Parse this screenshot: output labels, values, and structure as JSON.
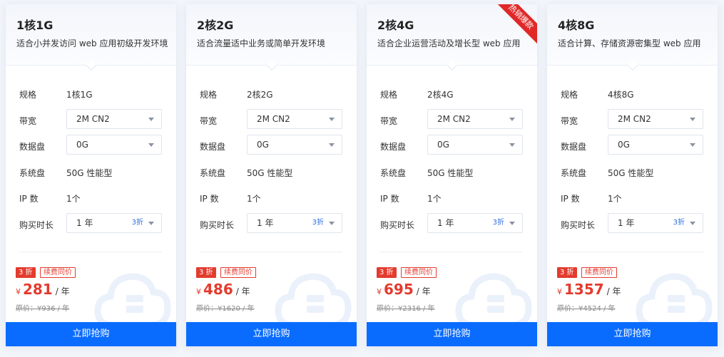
{
  "colors": {
    "accent": "#0a6cff",
    "price_red": "#e33b2e",
    "discount_blue": "#2d6fe0",
    "hot_ribbon": "#e02828"
  },
  "labels": {
    "spec": "规格",
    "bandwidth": "带宽",
    "data_disk": "数据盘",
    "system_disk": "系统盘",
    "ip_count": "IP 数",
    "duration": "购买时长"
  },
  "cards": [
    {
      "title": "1核1G",
      "desc": "适合小并发访问 web 应用初级开发环境",
      "hot": false,
      "spec": "1核1G",
      "bandwidth": "2M CN2",
      "data_disk": "0G",
      "system_disk": "50G 性能型",
      "ip": "1个",
      "duration": "1 年",
      "duration_discount": "3折",
      "discount_badge": "3 折",
      "renew_badge": "续费同价",
      "currency": "¥",
      "price": "281",
      "unit": "/ 年",
      "original_price": "原价：¥936 / 年",
      "buy_label": "立即抢购"
    },
    {
      "title": "2核2G",
      "desc": "适合流量适中业务或简单开发环境",
      "hot": false,
      "spec": "2核2G",
      "bandwidth": "2M CN2",
      "data_disk": "0G",
      "system_disk": "50G 性能型",
      "ip": "1个",
      "duration": "1 年",
      "duration_discount": "3折",
      "discount_badge": "3 折",
      "renew_badge": "续费同价",
      "currency": "¥",
      "price": "486",
      "unit": "/ 年",
      "original_price": "原价：¥1620 / 年",
      "buy_label": "立即抢购"
    },
    {
      "title": "2核4G",
      "desc": "适合企业运营活动及增长型 web 应用",
      "hot": true,
      "hot_label": "热销爆款",
      "spec": "2核4G",
      "bandwidth": "2M CN2",
      "data_disk": "0G",
      "system_disk": "50G 性能型",
      "ip": "1个",
      "duration": "1 年",
      "duration_discount": "3折",
      "discount_badge": "3 折",
      "renew_badge": "续费同价",
      "currency": "¥",
      "price": "695",
      "unit": "/ 年",
      "original_price": "原价：¥2316 / 年",
      "buy_label": "立即抢购"
    },
    {
      "title": "4核8G",
      "desc": "适合计算、存储资源密集型 web 应用",
      "hot": false,
      "spec": "4核8G",
      "bandwidth": "2M CN2",
      "data_disk": "0G",
      "system_disk": "50G 性能型",
      "ip": "1个",
      "duration": "1 年",
      "duration_discount": "3折",
      "discount_badge": "3 折",
      "renew_badge": "续费同价",
      "currency": "¥",
      "price": "1357",
      "unit": "/ 年",
      "original_price": "原价：¥4524 / 年",
      "buy_label": "立即抢购"
    }
  ]
}
